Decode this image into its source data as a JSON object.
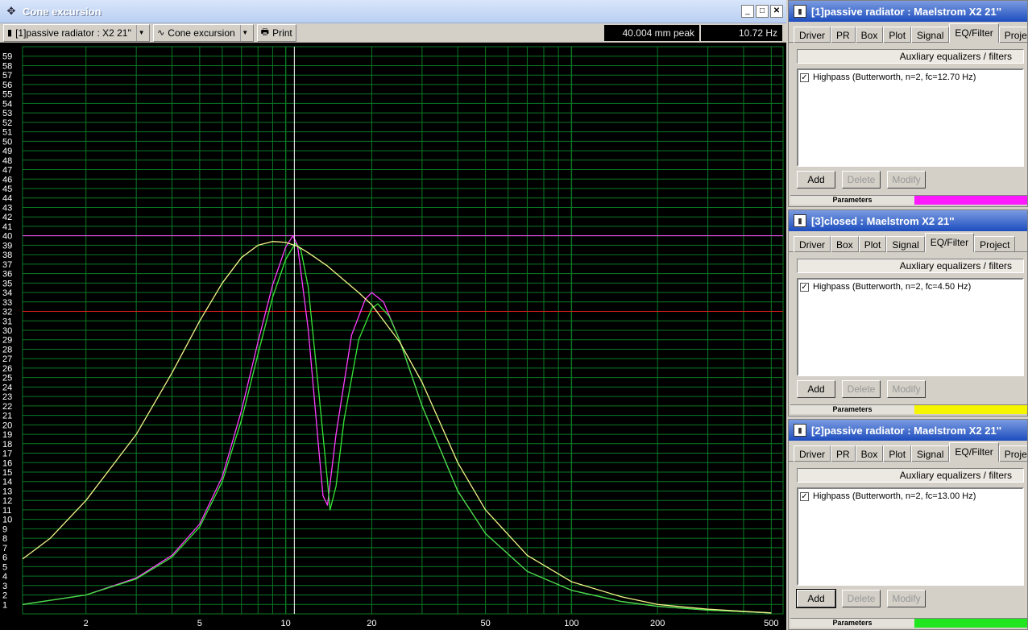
{
  "window": {
    "title": "Cone excursion",
    "buttons": {
      "minimize": "_",
      "maximize": "□",
      "close": "✕"
    }
  },
  "toolbar": {
    "project_select": "[1]passive radiator : X2 21''",
    "graph_select": "Cone excursion",
    "print_label": "Print",
    "readout_value": "40.004 mm peak",
    "readout_freq": "10.72 Hz"
  },
  "colors": {
    "plot_bg": "#000000",
    "grid": "#0a7a24",
    "magenta": "#ff3cff",
    "yellow": "#f4f48a",
    "green": "#38e638",
    "hline_magenta": "#ff4aff",
    "hline_red": "#e01e1e",
    "cursor": "#ffffff"
  },
  "chart_data": {
    "type": "line",
    "xscale": "log",
    "xlim": [
      1.2,
      550
    ],
    "ylim": [
      0,
      60
    ],
    "x_tick_labels": [
      "2",
      "5",
      "10",
      "20",
      "50",
      "100",
      "200",
      "500"
    ],
    "y_tick_labels": [
      "1",
      "2",
      "3",
      "4",
      "5",
      "6",
      "7",
      "8",
      "9",
      "10",
      "11",
      "12",
      "13",
      "14",
      "15",
      "16",
      "17",
      "18",
      "19",
      "20",
      "21",
      "22",
      "23",
      "24",
      "25",
      "26",
      "27",
      "28",
      "29",
      "30",
      "31",
      "32",
      "33",
      "34",
      "35",
      "36",
      "37",
      "38",
      "39",
      "40",
      "41",
      "42",
      "43",
      "44",
      "45",
      "46",
      "47",
      "48",
      "49",
      "50",
      "51",
      "52",
      "53",
      "54",
      "55",
      "56",
      "57",
      "58",
      "59"
    ],
    "cursor_x": 10.72,
    "hlines": [
      40.0,
      32.0
    ],
    "series": [
      {
        "color": "magenta",
        "x": [
          1.2,
          2,
          3,
          4,
          5,
          6,
          7,
          8,
          9,
          10,
          10.6,
          11,
          12,
          13,
          13.5,
          14,
          15,
          17,
          19,
          20,
          22,
          25,
          30,
          40,
          50,
          70,
          100,
          150,
          200,
          300,
          500
        ],
        "y": [
          1.0,
          2.0,
          3.8,
          6.2,
          9.5,
          14.5,
          21.5,
          28.8,
          34.8,
          38.8,
          40.0,
          39.0,
          30.0,
          18.0,
          12.5,
          11.5,
          19.0,
          29.5,
          33.3,
          34.0,
          33.0,
          29.0,
          22.0,
          13.0,
          8.5,
          4.5,
          2.5,
          1.3,
          0.8,
          0.4,
          0.1
        ]
      },
      {
        "color": "green",
        "x": [
          1.2,
          2,
          3,
          4,
          5,
          6,
          7,
          8,
          9,
          10,
          10.8,
          11.3,
          12,
          13,
          14,
          14.3,
          15,
          16,
          18,
          20,
          21,
          23,
          25,
          30,
          40,
          50,
          70,
          100,
          150,
          200,
          300,
          500
        ],
        "y": [
          1.0,
          2.0,
          3.7,
          6.0,
          9.2,
          14.0,
          20.5,
          27.5,
          33.5,
          37.5,
          39.2,
          38.5,
          34.5,
          24.0,
          14.0,
          11.0,
          13.5,
          20.5,
          29.0,
          32.3,
          32.8,
          31.5,
          29.0,
          22.0,
          13.0,
          8.5,
          4.5,
          2.5,
          1.3,
          0.8,
          0.4,
          0.1
        ]
      },
      {
        "color": "yellow",
        "x": [
          1.2,
          1.5,
          2,
          3,
          4,
          5,
          6,
          7,
          8,
          9,
          10,
          11,
          12,
          14,
          16,
          18,
          20,
          25,
          30,
          40,
          50,
          70,
          100,
          150,
          200,
          300,
          500
        ],
        "y": [
          5.8,
          8.0,
          12.0,
          19.0,
          25.5,
          31.0,
          35.0,
          37.7,
          39.0,
          39.4,
          39.3,
          38.9,
          38.2,
          36.8,
          35.3,
          34.0,
          32.7,
          28.8,
          24.5,
          16.0,
          11.0,
          6.2,
          3.4,
          1.8,
          1.0,
          0.5,
          0.1
        ]
      }
    ]
  },
  "panels": [
    {
      "title": "[1]passive radiator : Maelstrom X2 21''",
      "tabs": [
        "Driver",
        "PR",
        "Box",
        "Plot",
        "Signal",
        "EQ/Filter",
        "Proje"
      ],
      "active_tab": "EQ/Filter",
      "aux_header": "Auxliary equalizers / filters",
      "filter": "Highpass (Butterworth, n=2, fc=12.70 Hz)",
      "buttons": {
        "add": "Add",
        "delete": "Delete",
        "modify": "Modify"
      },
      "params_label": "Parameters",
      "color": "#ff19ff"
    },
    {
      "title": "[3]closed : Maelstrom X2 21''",
      "tabs": [
        "Driver",
        "Box",
        "Plot",
        "Signal",
        "EQ/Filter",
        "Project"
      ],
      "active_tab": "EQ/Filter",
      "aux_header": "Auxliary equalizers / filters",
      "filter": "Highpass (Butterworth, n=2, fc=4.50 Hz)",
      "buttons": {
        "add": "Add",
        "delete": "Delete",
        "modify": "Modify"
      },
      "params_label": "Parameters",
      "color": "#f5f500"
    },
    {
      "title": "[2]passive radiator : Maelstrom X2 21''",
      "tabs": [
        "Driver",
        "PR",
        "Box",
        "Plot",
        "Signal",
        "EQ/Filter",
        "Proje"
      ],
      "active_tab": "EQ/Filter",
      "aux_header": "Auxliary equalizers / filters",
      "filter": "Highpass (Butterworth, n=2, fc=13.00 Hz)",
      "buttons": {
        "add": "Add",
        "delete": "Delete",
        "modify": "Modify"
      },
      "params_label": "Parameters",
      "color": "#1fe61f"
    }
  ]
}
